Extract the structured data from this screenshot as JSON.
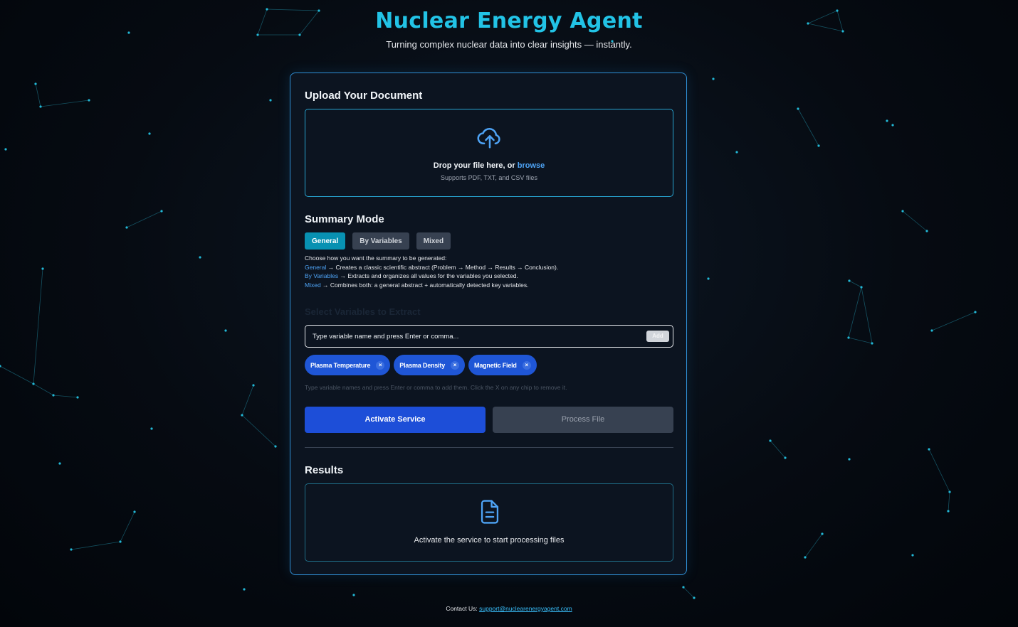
{
  "header": {
    "title": "Nuclear Energy Agent",
    "subtitle": "Turning complex nuclear data into clear insights — instantly."
  },
  "upload": {
    "heading": "Upload Your Document",
    "drop_text": "Drop your file here, or",
    "browse_label": "browse",
    "supported": "Supports PDF, TXT, and CSV files",
    "icon": "cloud-upload-icon"
  },
  "summary": {
    "heading": "Summary Mode",
    "modes": [
      {
        "label": "General",
        "active": true
      },
      {
        "label": "By Variables",
        "active": false
      },
      {
        "label": "Mixed",
        "active": false
      }
    ],
    "intro": "Choose how you want the summary to be generated:",
    "descriptions": [
      {
        "keyword": "General",
        "text": " → Creates a classic scientific abstract (Problem → Method → Results → Conclusion)."
      },
      {
        "keyword": "By Variables",
        "text": " → Extracts and organizes all values for the variables you selected."
      },
      {
        "keyword": "Mixed",
        "text": " → Combines both: a general abstract + automatically detected key variables."
      }
    ]
  },
  "variables": {
    "label": "Select Variables to Extract",
    "placeholder": "Type variable name and press Enter or comma...",
    "add_label": "Add",
    "chips": [
      "Plasma Temperature",
      "Plasma Density",
      "Magnetic Field"
    ],
    "remove_symbol": "×",
    "hint": "Type variable names and press Enter or comma to add them. Click the X on any chip to remove it."
  },
  "actions": {
    "activate_label": "Activate Service",
    "process_label": "Process File"
  },
  "results": {
    "heading": "Results",
    "empty_text": "Activate the service to start processing files",
    "icon": "document-icon"
  },
  "footer": {
    "contact_label": "Contact Us:",
    "email": "support@nuclearenergyagent.com"
  },
  "colors": {
    "accent": "#22c3e6",
    "primary_button": "#1d4ed8",
    "active_mode": "#0891b2",
    "link": "#4ea3f5"
  }
}
